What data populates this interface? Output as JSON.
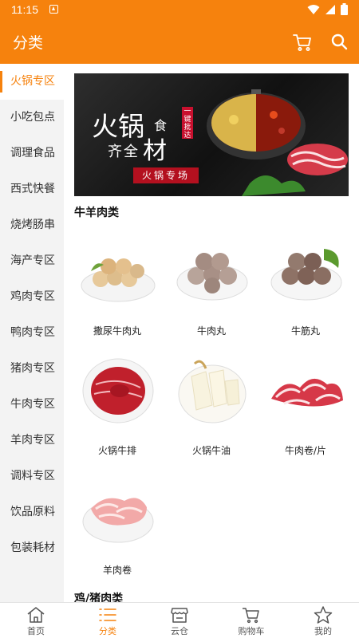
{
  "status": {
    "time": "11:15"
  },
  "appbar": {
    "title": "分类"
  },
  "sidebar": {
    "items": [
      {
        "label": "火锅专区",
        "active": true
      },
      {
        "label": "小吃包点"
      },
      {
        "label": "调理食品"
      },
      {
        "label": "西式快餐"
      },
      {
        "label": "烧烤肠串"
      },
      {
        "label": "海产专区"
      },
      {
        "label": "鸡肉专区"
      },
      {
        "label": "鸭肉专区"
      },
      {
        "label": "猪肉专区"
      },
      {
        "label": "牛肉专区"
      },
      {
        "label": "羊肉专区"
      },
      {
        "label": "调料专区"
      },
      {
        "label": "饮品原料"
      },
      {
        "label": "包装耗材"
      }
    ]
  },
  "banner": {
    "line1": "火锅",
    "line2": "食",
    "line3": "齐全",
    "line4": "材",
    "tag": "一键批达",
    "ribbon": "火锅专场"
  },
  "sections": [
    {
      "title": "牛羊肉类",
      "products": [
        {
          "name": "撒尿牛肉丸",
          "icon": "meatball-plate"
        },
        {
          "name": "牛肉丸",
          "icon": "meatball-plate"
        },
        {
          "name": "牛筋丸",
          "icon": "meatball-plate"
        },
        {
          "name": "火锅牛排",
          "icon": "beef-slices-plate"
        },
        {
          "name": "火锅牛油",
          "icon": "tallow-plate"
        },
        {
          "name": "牛肉卷/片",
          "icon": "beef-roll-pile"
        },
        {
          "name": "羊肉卷",
          "icon": "lamb-roll-plate"
        }
      ]
    },
    {
      "title": "鸡/猪肉类"
    }
  ],
  "bottomnav": {
    "tabs": [
      {
        "label": "首页",
        "icon": "home-icon"
      },
      {
        "label": "分类",
        "icon": "list-icon",
        "active": true
      },
      {
        "label": "云仓",
        "icon": "store-icon"
      },
      {
        "label": "购物车",
        "icon": "cart-icon"
      },
      {
        "label": "我的",
        "icon": "star-icon"
      }
    ]
  },
  "colors": {
    "accent": "#f6820d",
    "sidebar_bg": "#f3f3f3"
  }
}
